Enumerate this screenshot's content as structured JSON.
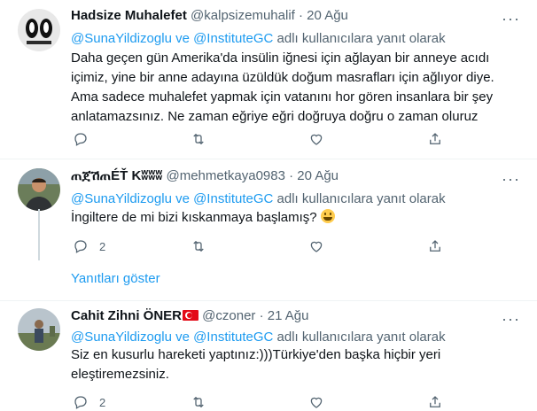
{
  "tweets": [
    {
      "name": "Hadsize Muhalefet",
      "handle": "@kalpsizemuhalif",
      "date": "20 Ağu",
      "reply_mentions": "@SunaYildizoglu ve @InstituteGC",
      "reply_suffix": " adlı kullanıcılara yanıt olarak",
      "lines": [
        "Daha geçen gün Amerika'da insülin iğnesi için ağlayan bir anneye acıdı",
        "içimiz, yine bir anne adayına üzüldük doğum masrafları için ağlıyor diye.",
        "Ama sadece muhalefet yapmak için vatanını hor gören insanlara bir şey",
        "anlatamazsınız. Ne zaman eğriye eğri doğruya doğru o zaman oluruz"
      ],
      "reply_count": "",
      "avatar_icon": "masked-figure-avatar"
    },
    {
      "name": "ጠጀሽጠÉŤ Kʬʬʬ",
      "handle": "@mehmetkaya0983",
      "date": "20 Ağu",
      "reply_mentions": "@SunaYildizoglu ve @InstituteGC",
      "reply_suffix": " adlı kullanıcılara yanıt olarak",
      "text": "İngiltere de mi bizi kıskanmaya başlamış? ",
      "reply_count": "2",
      "show_replies": "Yanıtları göster",
      "avatar_icon": "man-photo-avatar"
    },
    {
      "name": "Cahit Zihni ÖNER",
      "handle": "@czoner",
      "date": "21 Ağu",
      "reply_mentions": "@SunaYildizoglu ve @InstituteGC",
      "reply_suffix": " adlı kullanıcılara yanıt olarak",
      "lines": [
        "Siz en kusurlu hareketi yaptınız:)))Türkiye'den başka hiçbir yeri",
        "eleştiremezsiniz."
      ],
      "reply_count": "2",
      "avatar_icon": "outdoor-photo-avatar"
    }
  ],
  "separator": "·",
  "colors": {
    "link": "#1d9bf0",
    "muted": "#536471",
    "text": "#0f1419"
  }
}
